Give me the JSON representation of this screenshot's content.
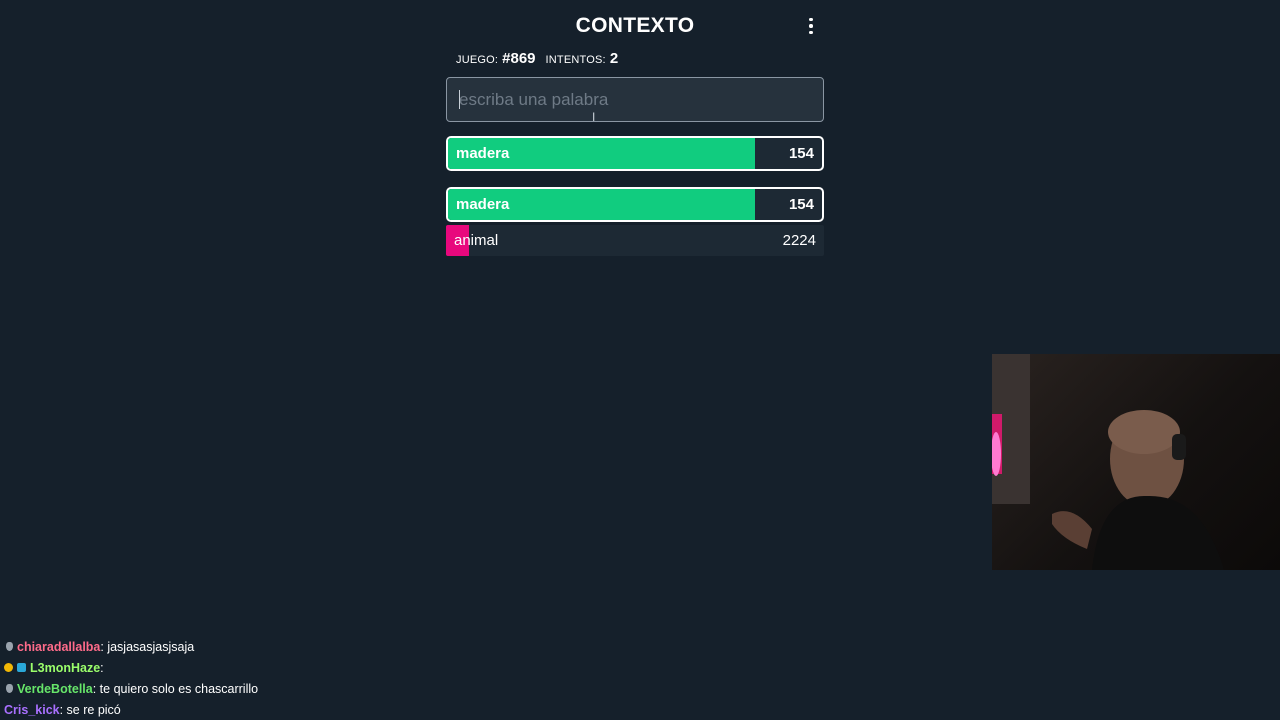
{
  "header": {
    "title": "CONTEXTO"
  },
  "info": {
    "game_label": "JUEGO:",
    "game_value": "#869",
    "attempts_label": "INTENTOS:",
    "attempts_value": "2"
  },
  "search": {
    "placeholder": "escriba una palabra",
    "value": ""
  },
  "last_guess": {
    "word": "madera",
    "distance": "154",
    "fill_fraction": 0.82,
    "color": "#11cc7f"
  },
  "guesses": [
    {
      "word": "madera",
      "distance": "154",
      "fill_fraction": 0.82,
      "color": "#11cc7f",
      "highlighted": true
    },
    {
      "word": "animal",
      "distance": "2224",
      "fill_fraction": 0.06,
      "color": "#e8087d",
      "highlighted": false
    }
  ],
  "chat": [
    {
      "user": "chiaradallalba",
      "text": "jasjasasjasjsaja",
      "user_color": "#ff6b8a",
      "badges": [
        "grey"
      ]
    },
    {
      "user": "L3monHaze",
      "text": "",
      "user_color": "#9bff6b",
      "badges": [
        "gold",
        "sq"
      ]
    },
    {
      "user": "VerdeBotella",
      "text": "te quiero solo es chascarrillo",
      "user_color": "#67e66a",
      "badges": [
        "grey"
      ]
    },
    {
      "user": "Cris_kick",
      "text": "se re picó",
      "user_color": "#a970ff",
      "badges": []
    }
  ],
  "colors": {
    "background": "#15202b",
    "close": "#11cc7f",
    "far": "#e8087d",
    "row_bg": "#1d2934"
  },
  "webcam": {
    "description_icon": "webcam-feed"
  }
}
